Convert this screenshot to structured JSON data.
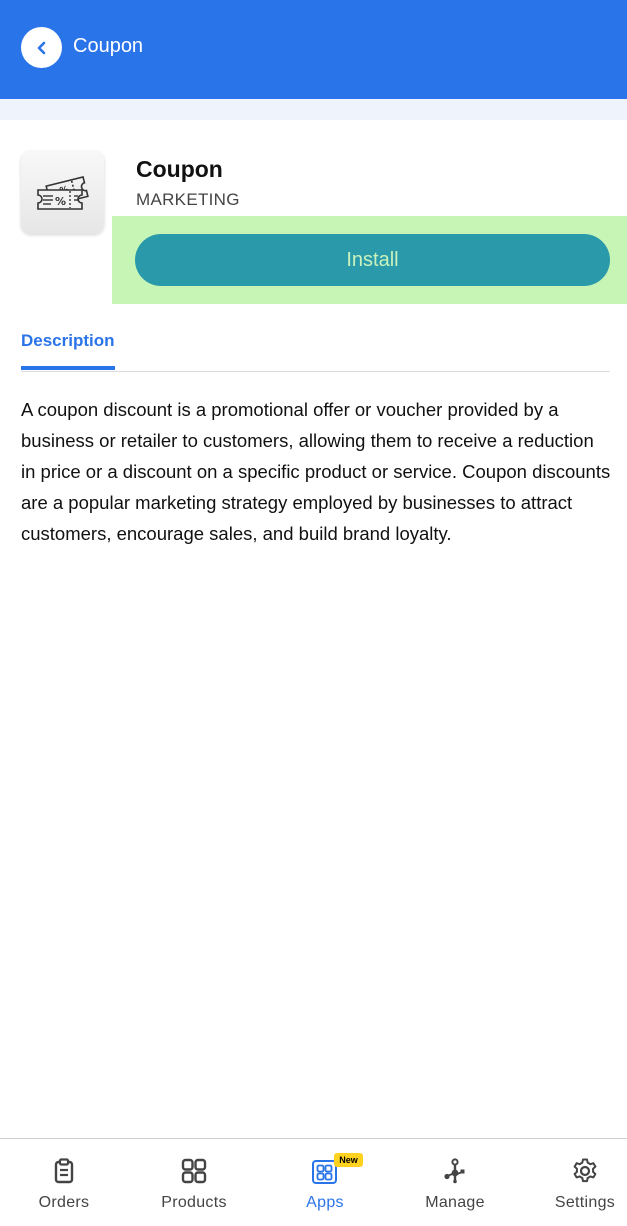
{
  "header": {
    "title": "Coupon",
    "back_icon": "chevron-left-icon",
    "background_color": "#2a74ea"
  },
  "app": {
    "icon": "coupon-ticket-icon",
    "name": "Coupon",
    "category": "MARKETING",
    "install_label": "Install",
    "install_color": "#2a9aab"
  },
  "tabs": [
    {
      "label": "Description",
      "active": true
    }
  ],
  "description": "A coupon discount is a promotional offer or voucher provided by a business or retailer to customers, allowing them to receive a reduction in price or a discount on a specific product or service. Coupon discounts are a popular marketing strategy employed by businesses to attract customers, encourage sales, and build brand loyalty.",
  "bottom_nav": {
    "items": [
      {
        "label": "Orders",
        "icon": "clipboard-icon",
        "active": false
      },
      {
        "label": "Products",
        "icon": "grid-icon",
        "active": false
      },
      {
        "label": "Apps",
        "icon": "apps-grid-icon",
        "active": true,
        "badge": "New"
      },
      {
        "label": "Manage",
        "icon": "network-icon",
        "active": false
      },
      {
        "label": "Settings",
        "icon": "gear-icon",
        "active": false
      }
    ],
    "accent_color": "#2a74ea",
    "badge_color": "#ffd21f"
  }
}
